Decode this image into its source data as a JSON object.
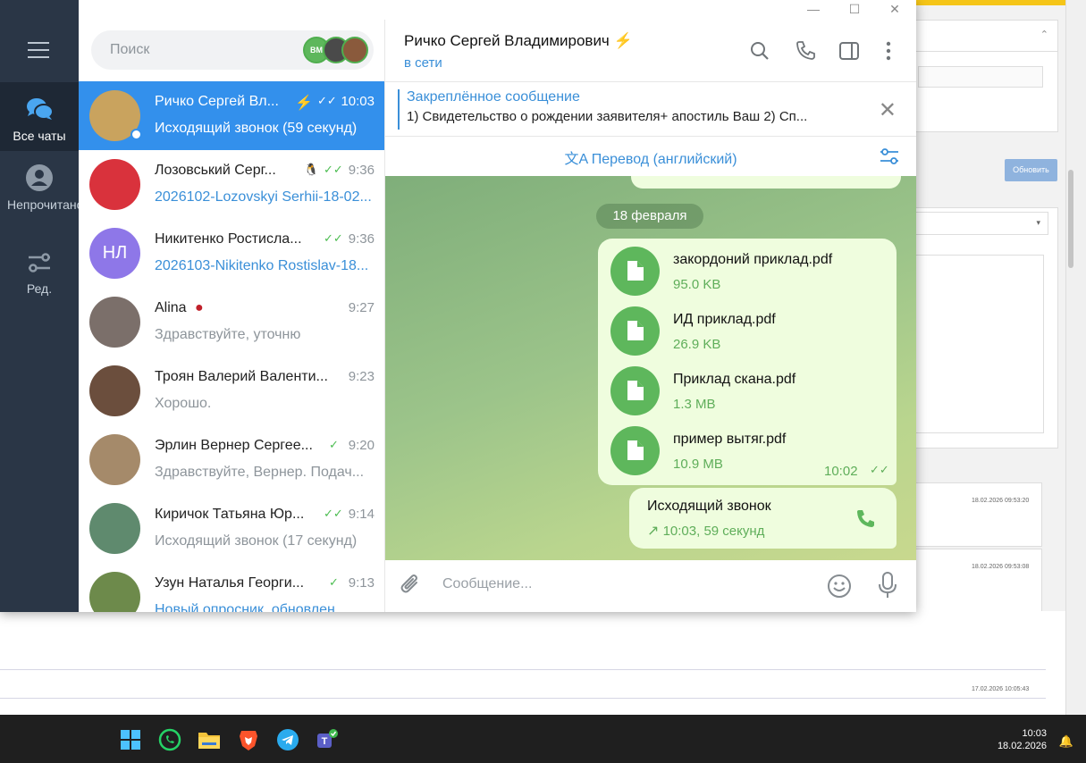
{
  "background_app": {
    "button_label": "Обновить",
    "timestamps": [
      "18.02.2026 09:53:20",
      "18.02.2026 09:53:08",
      "17.02.2026 10:05:43"
    ]
  },
  "taskbar": {
    "time": "10:03",
    "date": "18.02.2026",
    "icons": [
      "windows-start-icon",
      "whatsapp-icon",
      "file-explorer-icon",
      "brave-icon",
      "telegram-icon",
      "teams-icon"
    ]
  },
  "rail": {
    "items": [
      {
        "label": "Все чаты",
        "icon": "chats-icon",
        "active": true
      },
      {
        "label": "Непрочитано",
        "icon": "user-icon",
        "active": false
      },
      {
        "label": "Ред.",
        "icon": "filters-icon",
        "active": false
      }
    ]
  },
  "search": {
    "placeholder": "Поиск",
    "story_badge": "ВМ"
  },
  "chats": [
    {
      "name": "Ричко Сергей Вл...",
      "time": "10:03",
      "preview": "Исходящий звонок (59 секунд)",
      "avatar_text": "",
      "avatar_color": "#c9a35e",
      "active": true,
      "badge": "⚡",
      "checks": "✓✓"
    },
    {
      "name": "Лозовський Серг...",
      "time": "9:36",
      "preview": "2026102-Lozovskyi Serhii-18-02...",
      "avatar_text": "",
      "avatar_color": "#d9323c",
      "link": true,
      "badge": "🐧",
      "checks": "✓✓"
    },
    {
      "name": "Никитенко Ростисла...",
      "time": "9:36",
      "preview": "2026103-Nikitenko Rostislav-18...",
      "avatar_text": "НЛ",
      "avatar_color": "#8e77e8",
      "link": true,
      "checks": "✓✓"
    },
    {
      "name": "Alina",
      "time": "9:27",
      "preview": "Здравствуйте, уточню",
      "avatar_text": "",
      "avatar_color": "#7b6f6a",
      "badge": "●"
    },
    {
      "name": "Троян Валерий Валенти...",
      "time": "9:23",
      "preview": "Хорошо.",
      "avatar_text": "",
      "avatar_color": "#6b4e3d"
    },
    {
      "name": "Эрлин Вернер Сергее...",
      "time": "9:20",
      "preview": "Здравствуйте, Вернер. Подач...",
      "avatar_text": "",
      "avatar_color": "#a58a6a",
      "checks": "✓"
    },
    {
      "name": "Киричок Татьяна Юр...",
      "time": "9:14",
      "preview": "Исходящий звонок (17 секунд)",
      "avatar_text": "",
      "avatar_color": "#5f8a6e",
      "checks": "✓✓"
    },
    {
      "name": "Узун Наталья Георги...",
      "time": "9:13",
      "preview": "Новый опросник, обновлен",
      "avatar_text": "",
      "avatar_color": "#6d8a4b",
      "link": true,
      "checks": "✓"
    }
  ],
  "header": {
    "title": "Ричко Сергей Владимирович",
    "badge": "⚡",
    "status": "в сети"
  },
  "pinned": {
    "title": "Закреплённое сообщение",
    "text": "1) Свидетельство о рождении заявителя+ апостиль Ваш 2) Сп..."
  },
  "translate": {
    "label": "Перевод (английский)"
  },
  "messages": {
    "date": "18 февраля",
    "files": [
      {
        "name": "закордоний приклад.pdf",
        "size": "95.0 KB"
      },
      {
        "name": "ИД приклад.pdf",
        "size": "26.9 KB"
      },
      {
        "name": "Приклад скана.pdf",
        "size": "1.3 MB"
      },
      {
        "name": "пример вытяг.pdf",
        "size": "10.9 MB"
      }
    ],
    "files_time": "10:02",
    "call": {
      "title": "Исходящий звонок",
      "detail": "10:03, 59 секунд"
    }
  },
  "composer": {
    "placeholder": "Сообщение..."
  },
  "colors": {
    "accent": "#3390ec",
    "rail": "#2a3646",
    "bubble": "#effdde",
    "file_icon": "#5eb75c"
  }
}
